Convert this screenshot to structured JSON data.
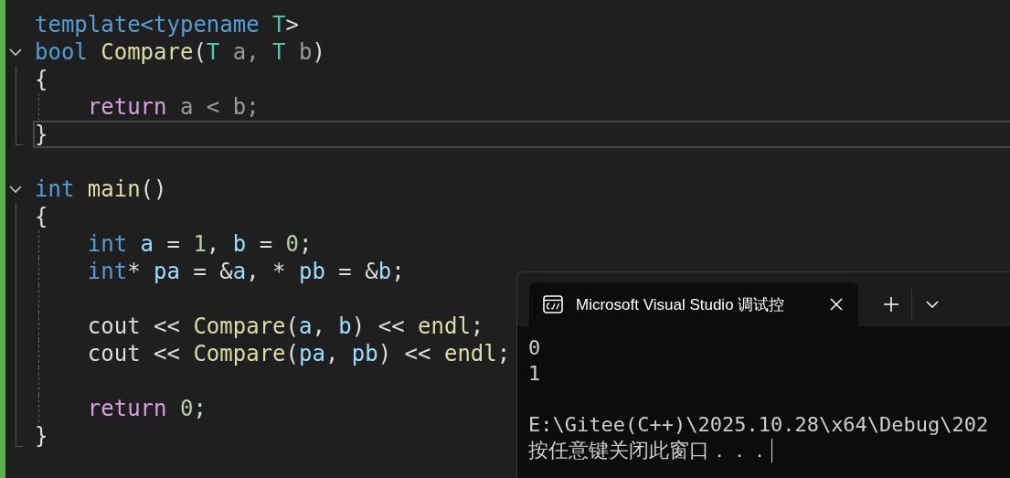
{
  "editor": {
    "lines": [
      {
        "current": false,
        "tokens": [
          {
            "text": "template<typename ",
            "kind": "keyword"
          },
          {
            "text": "T",
            "kind": "type"
          },
          {
            "text": ">",
            "kind": "plain"
          }
        ]
      },
      {
        "current": false,
        "expanded": true,
        "tokens": [
          {
            "text": "bool ",
            "kind": "keyword"
          },
          {
            "text": "Compare",
            "kind": "function"
          },
          {
            "text": "(",
            "kind": "plain"
          },
          {
            "text": "T",
            "kind": "type"
          },
          {
            "text": " a, ",
            "kind": "param"
          },
          {
            "text": "T",
            "kind": "type"
          },
          {
            "text": " b",
            "kind": "param"
          },
          {
            "text": ")",
            "kind": "plain"
          }
        ]
      },
      {
        "current": false,
        "tokens": [
          {
            "text": "{",
            "kind": "plain"
          }
        ]
      },
      {
        "current": false,
        "tokens": [
          {
            "text": "    return",
            "kind": "control"
          },
          {
            "text": " a < b;",
            "kind": "param"
          }
        ]
      },
      {
        "current": true,
        "tokens": [
          {
            "text": "}",
            "kind": "plain"
          }
        ]
      },
      {
        "current": false
      },
      {
        "current": false,
        "expanded": true,
        "tokens": [
          {
            "text": "int ",
            "kind": "keyword"
          },
          {
            "text": "main",
            "kind": "function"
          },
          {
            "text": "()",
            "kind": "plain"
          }
        ]
      },
      {
        "current": false,
        "tokens": [
          {
            "text": "{",
            "kind": "plain"
          }
        ]
      },
      {
        "current": false,
        "tokens": [
          {
            "text": "    int ",
            "kind": "keyword"
          },
          {
            "text": "a",
            "kind": "variable"
          },
          {
            "text": " = ",
            "kind": "plain"
          },
          {
            "text": "1",
            "kind": "number"
          },
          {
            "text": ", ",
            "kind": "plain"
          },
          {
            "text": "b",
            "kind": "variable"
          },
          {
            "text": " = ",
            "kind": "plain"
          },
          {
            "text": "0",
            "kind": "number"
          },
          {
            "text": ";",
            "kind": "plain"
          }
        ]
      },
      {
        "current": false,
        "tokens": [
          {
            "text": "    int",
            "kind": "keyword"
          },
          {
            "text": "* ",
            "kind": "plain"
          },
          {
            "text": "pa",
            "kind": "variable"
          },
          {
            "text": " = &",
            "kind": "plain"
          },
          {
            "text": "a",
            "kind": "variable"
          },
          {
            "text": ", * ",
            "kind": "plain"
          },
          {
            "text": "pb",
            "kind": "variable"
          },
          {
            "text": " = &",
            "kind": "plain"
          },
          {
            "text": "b",
            "kind": "variable"
          },
          {
            "text": ";",
            "kind": "plain"
          }
        ]
      },
      {
        "current": false
      },
      {
        "current": false,
        "tokens": [
          {
            "text": "    cout << ",
            "kind": "plain"
          },
          {
            "text": "Compare",
            "kind": "function"
          },
          {
            "text": "(",
            "kind": "plain"
          },
          {
            "text": "a",
            "kind": "variable"
          },
          {
            "text": ", ",
            "kind": "plain"
          },
          {
            "text": "b",
            "kind": "variable"
          },
          {
            "text": ") << ",
            "kind": "plain"
          },
          {
            "text": "endl",
            "kind": "function"
          },
          {
            "text": ";",
            "kind": "plain"
          }
        ]
      },
      {
        "current": false,
        "tokens": [
          {
            "text": "    cout << ",
            "kind": "plain"
          },
          {
            "text": "Compare",
            "kind": "function"
          },
          {
            "text": "(",
            "kind": "plain"
          },
          {
            "text": "pa",
            "kind": "variable"
          },
          {
            "text": ", ",
            "kind": "plain"
          },
          {
            "text": "pb",
            "kind": "variable"
          },
          {
            "text": ") << ",
            "kind": "plain"
          },
          {
            "text": "endl",
            "kind": "function"
          },
          {
            "text": ";",
            "kind": "plain"
          }
        ]
      },
      {
        "current": false
      },
      {
        "current": false,
        "tokens": [
          {
            "text": "    return ",
            "kind": "control"
          },
          {
            "text": "0",
            "kind": "number"
          },
          {
            "text": ";",
            "kind": "plain"
          }
        ]
      },
      {
        "current": false,
        "tokens": [
          {
            "text": "}",
            "kind": "plain"
          }
        ]
      }
    ]
  },
  "terminal": {
    "tabs": [
      {
        "title": "Microsoft Visual Studio 调试控",
        "selected": true
      }
    ],
    "output": [
      {
        "text": "0"
      },
      {
        "text": "1"
      },
      {
        "text": "E:\\Gitee(C++)\\2025.10.28\\x64\\Debug\\202",
        "blank_before": true
      },
      {
        "text": "按任意键关闭此窗口．．．",
        "cursor": true
      }
    ]
  }
}
